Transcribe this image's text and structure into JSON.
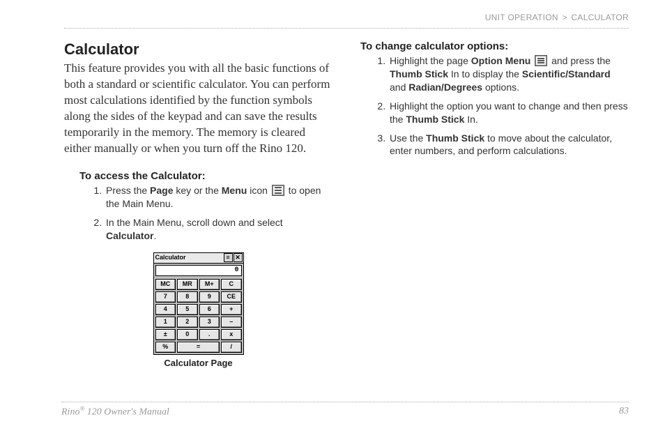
{
  "breadcrumb": {
    "section": "Unit Operation",
    "sep": ">",
    "page": "Calculator"
  },
  "title": "Calculator",
  "intro": "This feature provides you with all the basic functions of both a standard or scientific calculator. You can perform most calculations identified by the function symbols along the sides of the keypad and can save the results temporarily in the memory. The memory is cleared either manually or when you turn off the Rino 120.",
  "access": {
    "heading": "To access the Calculator:",
    "step1a": "Press the ",
    "step1b": "Page",
    "step1c": " key or the ",
    "step1d": "Menu",
    "step1e": " icon ",
    "step1f": " to open the Main Menu.",
    "step2a": "In the Main Menu, scroll down and select ",
    "step2b": "Calculator",
    "step2c": "."
  },
  "change": {
    "heading": "To change calculator options:",
    "step1a": "Highlight the page ",
    "step1b": "Option Menu",
    "step1c": " and press the ",
    "step1d": "Thumb Stick",
    "step1e": " In to display the ",
    "step1f": "Scientific/Standard",
    "step1g": " and ",
    "step1h": "Radian/Degrees",
    "step1i": " options.",
    "step2a": "Highlight the option you want to change and then press the ",
    "step2b": "Thumb Stick",
    "step2c": " In.",
    "step3a": "Use the ",
    "step3b": "Thumb Stick",
    "step3c": " to move about the calculator, enter numbers, and perform calculations."
  },
  "calculator": {
    "window_title": "Calculator",
    "btn_menu": "≡",
    "btn_close": "✕",
    "display": "0",
    "keys": [
      "MC",
      "MR",
      "M+",
      "C",
      "7",
      "8",
      "9",
      "CE",
      "4",
      "5",
      "6",
      "+",
      "1",
      "2",
      "3",
      "–",
      "±",
      "0",
      ".",
      "x",
      "%",
      "=",
      "/"
    ],
    "caption": "Calculator Page"
  },
  "footer": {
    "manual_a": "Rino",
    "manual_reg": "®",
    "manual_b": " 120 Owner's Manual",
    "page_num": "83"
  }
}
